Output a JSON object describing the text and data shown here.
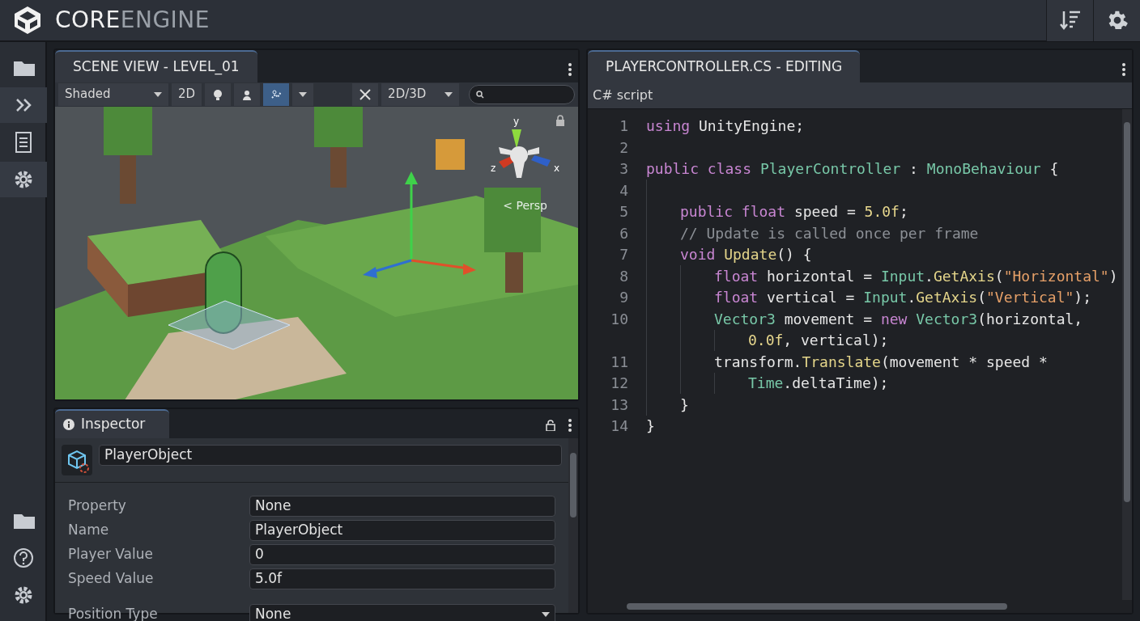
{
  "app": {
    "title_primary": "CORE",
    "title_secondary": "ENGINE"
  },
  "sidebar": {
    "top_items": [
      {
        "selected": false
      },
      {
        "selected": true
      },
      {
        "selected": false
      },
      {
        "selected": true
      }
    ],
    "bottom_items": [
      {
        "selected": false
      },
      {
        "selected": false
      },
      {
        "selected": false
      }
    ]
  },
  "scene": {
    "tab": "SCENE VIEW - LEVEL_01",
    "toolbar": [
      {
        "kind": "dropdown",
        "label": "Shaded",
        "selected": false
      },
      {
        "kind": "button",
        "label": "2D",
        "selected": false
      },
      {
        "kind": "icon",
        "selected": false
      },
      {
        "kind": "icon",
        "selected": false
      },
      {
        "kind": "icon",
        "selected": true
      },
      {
        "kind": "caret",
        "selected": false
      },
      {
        "kind": "spacer"
      },
      {
        "kind": "icon",
        "selected": false
      },
      {
        "kind": "dropdown",
        "label": "2D/3D",
        "selected": false
      },
      {
        "kind": "search"
      }
    ],
    "gizmo": {
      "y": "y",
      "z": "z",
      "x": "x",
      "projection": "< Persp"
    }
  },
  "inspector": {
    "tab": "Inspector",
    "object_name": "PlayerObject",
    "properties": [
      {
        "label": "Property",
        "value": "None",
        "kind": "text"
      },
      {
        "label": "Name",
        "value": "PlayerObject",
        "kind": "text"
      },
      {
        "label": "Player Value",
        "value": "0",
        "kind": "text"
      },
      {
        "label": "Speed Value",
        "value": "5.0f",
        "kind": "text"
      },
      {
        "label": "Position Type",
        "value": "None",
        "kind": "dropdown"
      }
    ]
  },
  "editor": {
    "tab": "PLAYERCONTROLLER.CS - EDITING",
    "subtitle": "C# script",
    "lines": [
      {
        "number": "1",
        "tokens": [
          {
            "text": "using",
            "kind": "keyword"
          },
          {
            "text": " UnityEngine;",
            "kind": "plain"
          }
        ]
      },
      {
        "number": "2"
      },
      {
        "number": "3",
        "tokens": [
          {
            "text": "public class",
            "kind": "keyword"
          },
          {
            "text": " PlayerController",
            "kind": "type"
          },
          {
            "text": " : ",
            "kind": "plain"
          },
          {
            "text": "MonoBehaviour",
            "kind": "type"
          },
          {
            "text": " {",
            "kind": "plain"
          }
        ],
        "children": [
          {
            "number": "4"
          },
          {
            "number": "5",
            "tokens": [
              {
                "text": "public float",
                "kind": "keyword"
              },
              {
                "text": " speed = ",
                "kind": "plain"
              },
              {
                "text": "5.0f",
                "kind": "number"
              },
              {
                "text": ";",
                "kind": "plain"
              }
            ]
          },
          {
            "number": "6",
            "tokens": [
              {
                "text": "// Update is called once per frame",
                "kind": "comment"
              }
            ]
          },
          {
            "number": "7",
            "tokens": [
              {
                "text": "void",
                "kind": "keyword"
              },
              {
                "text": " Update",
                "kind": "method"
              },
              {
                "text": "() {",
                "kind": "plain"
              }
            ],
            "children": [
              {
                "number": "8",
                "tokens": [
                  {
                    "text": "float",
                    "kind": "keyword"
                  },
                  {
                    "text": " horizontal = ",
                    "kind": "plain"
                  },
                  {
                    "text": "Input",
                    "kind": "type"
                  },
                  {
                    "text": ".",
                    "kind": "plain"
                  },
                  {
                    "text": "GetAxis",
                    "kind": "method"
                  },
                  {
                    "text": "(",
                    "kind": "plain"
                  },
                  {
                    "text": "\"Horizontal\"",
                    "kind": "string"
                  },
                  {
                    "text": ")",
                    "kind": "plain"
                  }
                ]
              },
              {
                "number": "9",
                "tokens": [
                  {
                    "text": "float",
                    "kind": "keyword"
                  },
                  {
                    "text": " vertical = ",
                    "kind": "plain"
                  },
                  {
                    "text": "Input",
                    "kind": "type"
                  },
                  {
                    "text": ".",
                    "kind": "plain"
                  },
                  {
                    "text": "GetAxis",
                    "kind": "method"
                  },
                  {
                    "text": "(",
                    "kind": "plain"
                  },
                  {
                    "text": "\"Vertical\"",
                    "kind": "string"
                  },
                  {
                    "text": ");",
                    "kind": "plain"
                  }
                ]
              },
              {
                "number": "10",
                "tokens": [
                  {
                    "text": "Vector3",
                    "kind": "type"
                  },
                  {
                    "text": " movement = ",
                    "kind": "plain"
                  },
                  {
                    "text": "new",
                    "kind": "keyword"
                  },
                  {
                    "text": " Vector3",
                    "kind": "type"
                  },
                  {
                    "text": "(horizontal,",
                    "kind": "plain"
                  }
                ],
                "children": [
                  {
                    "tokens": [
                      {
                        "text": "0.0f",
                        "kind": "number"
                      },
                      {
                        "text": ", vertical);",
                        "kind": "plain"
                      }
                    ]
                  }
                ]
              },
              {
                "number": "11",
                "tokens": [
                  {
                    "text": "transform.",
                    "kind": "plain"
                  },
                  {
                    "text": "Translate",
                    "kind": "method"
                  },
                  {
                    "text": "(movement * speed *",
                    "kind": "plain"
                  }
                ],
                "children": [
                  {
                    "number": "12",
                    "tokens": [
                      {
                        "text": "Time",
                        "kind": "type"
                      },
                      {
                        "text": ".deltaTime);",
                        "kind": "plain"
                      }
                    ]
                  }
                ]
              }
            ]
          },
          {
            "number": "13",
            "tokens": [
              {
                "text": "}",
                "kind": "plain"
              }
            ]
          }
        ]
      },
      {
        "number": "14",
        "tokens": [
          {
            "text": "}",
            "kind": "plain"
          }
        ]
      }
    ]
  }
}
